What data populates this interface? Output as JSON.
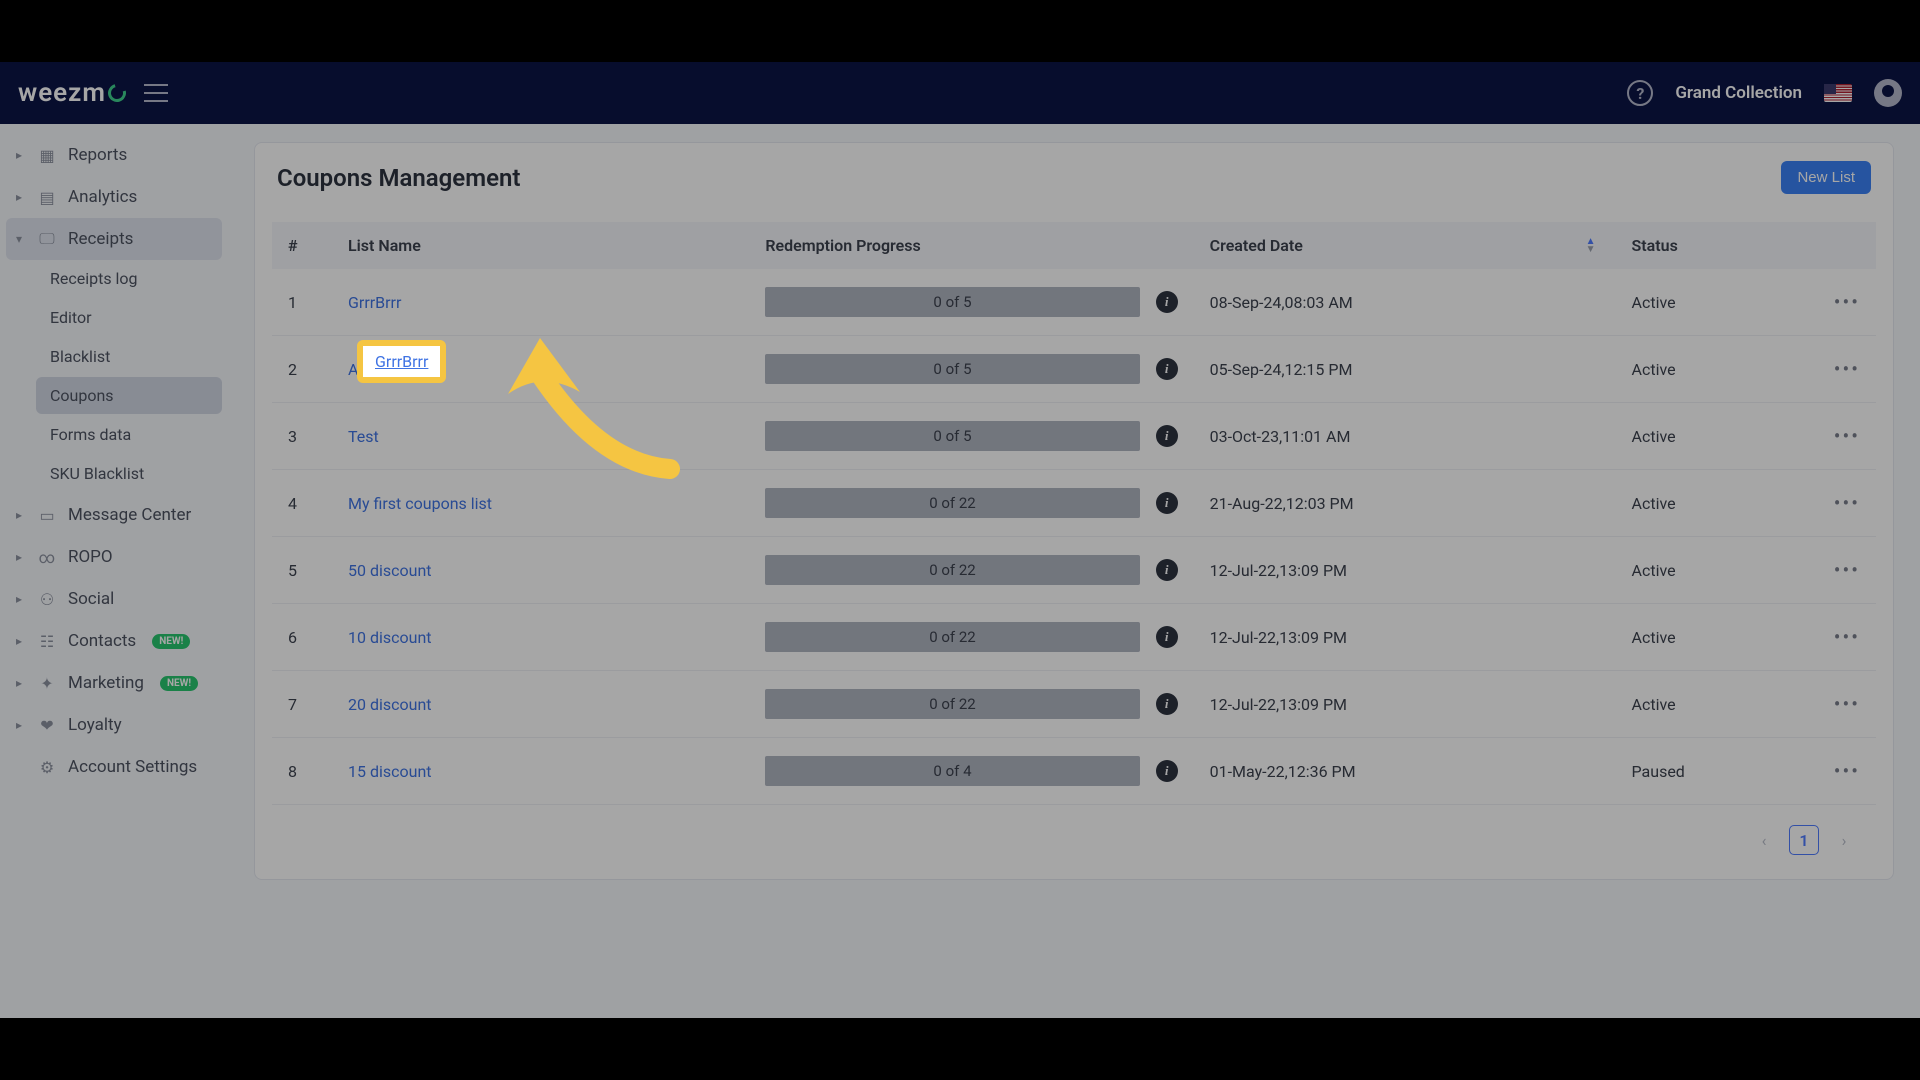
{
  "header": {
    "brand": "weezm",
    "business": "Grand Collection"
  },
  "sidebar": {
    "items": [
      {
        "label": "Reports",
        "icon": "▦",
        "expandable": true
      },
      {
        "label": "Analytics",
        "icon": "▤",
        "expandable": true
      },
      {
        "label": "Receipts",
        "icon": "🖵",
        "expandable": true,
        "expanded": true,
        "children": [
          {
            "label": "Receipts log"
          },
          {
            "label": "Editor"
          },
          {
            "label": "Blacklist"
          },
          {
            "label": "Coupons",
            "selected": true
          },
          {
            "label": "Forms data"
          },
          {
            "label": "SKU Blacklist"
          }
        ]
      },
      {
        "label": "Message Center",
        "icon": "▭",
        "expandable": true
      },
      {
        "label": "ROPO",
        "icon": "∞",
        "expandable": true
      },
      {
        "label": "Social",
        "icon": "⚇",
        "expandable": true
      },
      {
        "label": "Contacts",
        "icon": "☷",
        "expandable": true,
        "badge": "NEW!"
      },
      {
        "label": "Marketing",
        "icon": "✦",
        "expandable": true,
        "badge": "NEW!"
      },
      {
        "label": "Loyalty",
        "icon": "❤",
        "expandable": true
      },
      {
        "label": "Account Settings",
        "icon": "⚙",
        "expandable": false
      }
    ]
  },
  "page": {
    "title": "Coupons Management",
    "new_button": "New List",
    "columns": {
      "idx": "#",
      "name": "List Name",
      "progress": "Redemption Progress",
      "date": "Created Date",
      "status": "Status"
    },
    "rows": [
      {
        "idx": "1",
        "name": "GrrrBrrr",
        "progress": "0 of 5",
        "date": "08-Sep-24,08:03 AM",
        "status": "Active"
      },
      {
        "idx": "2",
        "name": "Adistest",
        "progress": "0 of 5",
        "date": "05-Sep-24,12:15 PM",
        "status": "Active"
      },
      {
        "idx": "3",
        "name": "Test",
        "progress": "0 of 5",
        "date": "03-Oct-23,11:01 AM",
        "status": "Active"
      },
      {
        "idx": "4",
        "name": "My first coupons list",
        "progress": "0 of 22",
        "date": "21-Aug-22,12:03 PM",
        "status": "Active"
      },
      {
        "idx": "5",
        "name": "50 discount",
        "progress": "0 of 22",
        "date": "12-Jul-22,13:09 PM",
        "status": "Active"
      },
      {
        "idx": "6",
        "name": "10 discount",
        "progress": "0 of 22",
        "date": "12-Jul-22,13:09 PM",
        "status": "Active"
      },
      {
        "idx": "7",
        "name": "20 discount",
        "progress": "0 of 22",
        "date": "12-Jul-22,13:09 PM",
        "status": "Active"
      },
      {
        "idx": "8",
        "name": "15 discount",
        "progress": "0 of 4",
        "date": "01-May-22,12:36 PM",
        "status": "Paused"
      }
    ],
    "pager": {
      "page": "1"
    },
    "highlight_link": "GrrrBrrr"
  }
}
